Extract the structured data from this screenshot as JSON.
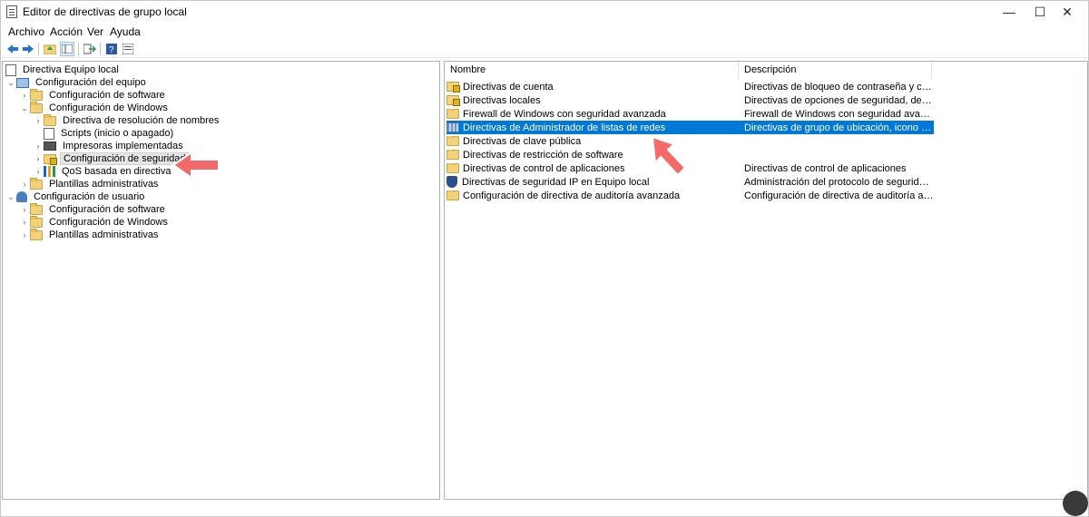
{
  "window": {
    "title": "Editor de directivas de grupo local",
    "minimize": "—",
    "maximize": "☐",
    "close": "✕"
  },
  "menu": [
    "Archivo",
    "Acción",
    "Ver",
    "Ayuda"
  ],
  "tree": [
    {
      "label": "Directiva Equipo local"
    },
    {
      "label": "Configuración del equipo"
    },
    {
      "label": "Configuración de software"
    },
    {
      "label": "Configuración de Windows"
    },
    {
      "label": "Directiva de resolución de nombres"
    },
    {
      "label": "Scripts (inicio o apagado)"
    },
    {
      "label": "Impresoras implementadas"
    },
    {
      "label": "Configuración de seguridad"
    },
    {
      "label": "QoS basada en directiva"
    },
    {
      "label": "Plantillas administrativas"
    },
    {
      "label": "Configuración de usuario"
    },
    {
      "label": "Configuración de software"
    },
    {
      "label": "Configuración de Windows"
    },
    {
      "label": "Plantillas administrativas"
    }
  ],
  "columns": {
    "name": "Nombre",
    "description": "Descripción"
  },
  "rows": [
    {
      "name": "Directivas de cuenta",
      "description": "Directivas de bloqueo de contraseña y cuenta"
    },
    {
      "name": "Directivas locales",
      "description": "Directivas de opciones de seguridad, derechos ..."
    },
    {
      "name": "Firewall de Windows con seguridad avanzada",
      "description": "Firewall de Windows con seguridad avanzada"
    },
    {
      "name": "Directivas de Administrador de listas de redes",
      "description": "Directivas de grupo de ubicación, icono y nom..."
    },
    {
      "name": "Directivas de clave pública",
      "description": ""
    },
    {
      "name": "Directivas de restricción de software",
      "description": ""
    },
    {
      "name": "Directivas de control de aplicaciones",
      "description": "Directivas de control de aplicaciones"
    },
    {
      "name": "Directivas de seguridad IP en Equipo local",
      "description": "Administración del protocolo de seguridad de I..."
    },
    {
      "name": "Configuración de directiva de auditoría avanzada",
      "description": "Configuración de directiva de auditoría avanzada"
    }
  ],
  "colors": {
    "selection": "#0078d7",
    "arrow": "#f26a6a"
  }
}
